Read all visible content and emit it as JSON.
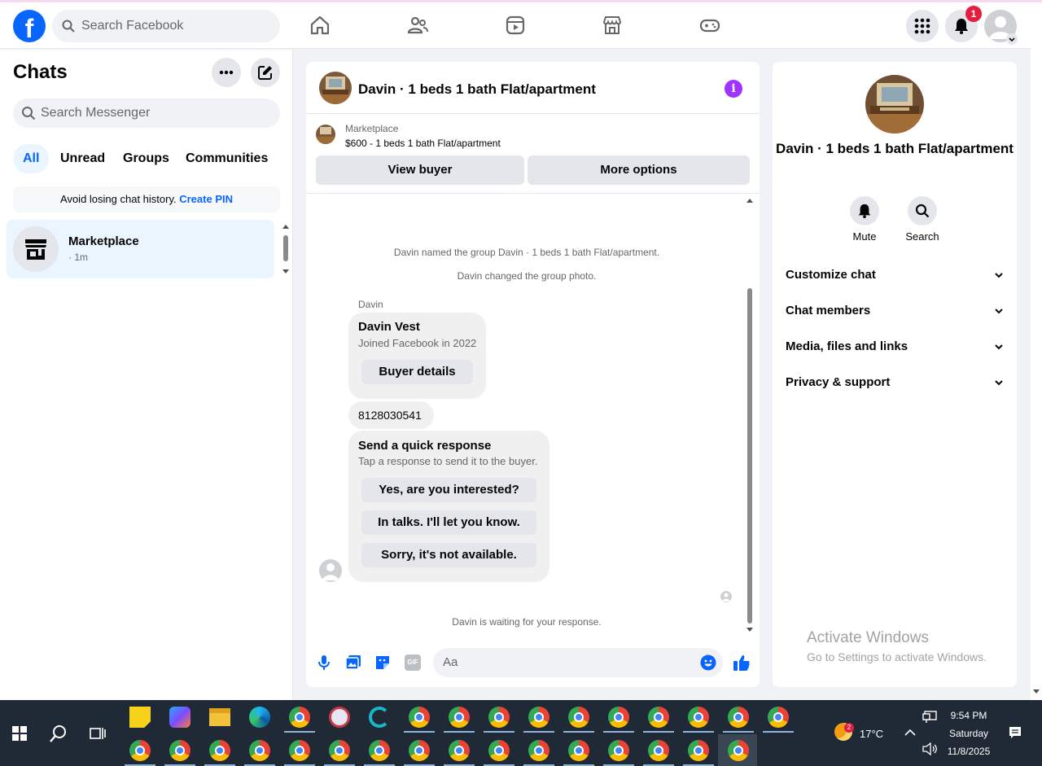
{
  "topbar": {
    "search_placeholder": "Search Facebook",
    "notification_count": "1",
    "logo_letter": "f"
  },
  "left": {
    "title": "Chats",
    "search_placeholder": "Search Messenger",
    "filters": [
      "All",
      "Unread",
      "Groups",
      "Communities"
    ],
    "pin_text": "Avoid losing chat history.",
    "pin_link": "Create PIN",
    "chat": {
      "name": "Marketplace",
      "time": "· 1m"
    }
  },
  "center": {
    "title": "Davin · 1 beds 1 bath Flat/apartment",
    "mp_label": "Marketplace",
    "mp_listing": "$600 - 1 beds 1 bath Flat/apartment",
    "view_buyer": "View buyer",
    "more_options": "More options",
    "sys1": "Davin named the group Davin · 1 beds 1 bath Flat/apartment.",
    "sys2": "Davin changed the group photo.",
    "sender": "Davin",
    "buyer_card": {
      "name": "Davin Vest",
      "joined": "Joined Facebook in 2022",
      "button": "Buyer details"
    },
    "phone": "8128030541",
    "quick": {
      "title": "Send a quick response",
      "subtitle": "Tap a response to send it to the buyer.",
      "options": [
        "Yes, are you interested?",
        "In talks. I'll let you know.",
        "Sorry, it's not available."
      ]
    },
    "waiting": "Davin is waiting for your response.",
    "composer_placeholder": "Aa",
    "gif_label": "GIF"
  },
  "right": {
    "name": "Davin · 1 beds 1 bath Flat/apartment",
    "mute": "Mute",
    "search": "Search",
    "rows": [
      "Customize chat",
      "Chat members",
      "Media, files and links",
      "Privacy & support"
    ]
  },
  "watermark": {
    "line1": "Activate Windows",
    "line2": "Go to Settings to activate Windows."
  },
  "taskbar": {
    "weather": "17°C",
    "weather_badge": "2",
    "time": "9:54 PM",
    "day": "Saturday",
    "date": "11/8/2025"
  },
  "colors": {
    "accent": "#0866ff",
    "badge": "#e41e3f",
    "info": "#a033ff"
  }
}
